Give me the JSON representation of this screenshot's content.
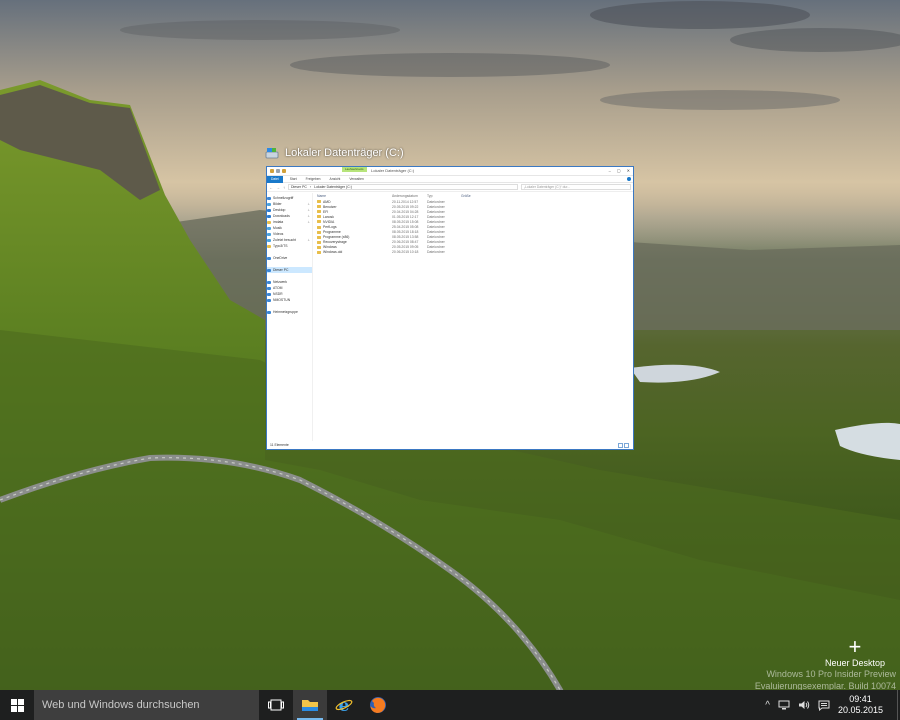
{
  "task_view": {
    "window_title": "Lokaler Datenträger (C:)"
  },
  "explorer": {
    "context_tab": "Laufwerktools",
    "title": "Lokaler Datenträger (C:)",
    "controls": [
      "–",
      "▢",
      "✕"
    ],
    "ribbon_tabs": [
      "Datei",
      "Start",
      "Freigeben",
      "Ansicht",
      "Verwalten"
    ],
    "address_parts": [
      "Dieser PC",
      "Lokaler Datenträger (C:)"
    ],
    "search_placeholder": "„Lokaler Datenträger (C:)“ dur...",
    "nav_items": [
      {
        "label": "Schnellzugriff",
        "icon": "star-icon",
        "color": "#3a86d6",
        "pinned": false,
        "selected": false
      },
      {
        "label": "Bilder",
        "icon": "pictures-icon",
        "color": "#4aa3df",
        "pinned": true,
        "selected": false
      },
      {
        "label": "Desktop",
        "icon": "desktop-icon",
        "color": "#2b7bd0",
        "pinned": true,
        "selected": false
      },
      {
        "label": "Downloads",
        "icon": "download-icon",
        "color": "#2b7bd0",
        "pinned": true,
        "selected": false
      },
      {
        "label": "imdata",
        "icon": "folder-icon",
        "color": "#e8be4a",
        "pinned": true,
        "selected": false
      },
      {
        "label": "Musik",
        "icon": "music-icon",
        "color": "#4aa3df",
        "pinned": false,
        "selected": false
      },
      {
        "label": "Videos",
        "icon": "video-icon",
        "color": "#4aa3df",
        "pinned": false,
        "selected": false
      },
      {
        "label": "Zuletzt besucht",
        "icon": "recent-icon",
        "color": "#4aa3df",
        "pinned": true,
        "selected": false
      },
      {
        "label": "Typo3/TS",
        "icon": "folder-icon",
        "color": "#e8be4a",
        "pinned": false,
        "selected": false
      },
      {
        "label": "",
        "icon": "",
        "color": "",
        "pinned": false,
        "selected": false
      },
      {
        "label": "OneDrive",
        "icon": "cloud-icon",
        "color": "#3a86d6",
        "pinned": false,
        "selected": false
      },
      {
        "label": "",
        "icon": "",
        "color": "",
        "pinned": false,
        "selected": false
      },
      {
        "label": "Dieser PC",
        "icon": "computer-icon",
        "color": "#3a86d6",
        "pinned": false,
        "selected": true
      },
      {
        "label": "",
        "icon": "",
        "color": "",
        "pinned": false,
        "selected": false
      },
      {
        "label": "Netzwerk",
        "icon": "network-icon",
        "color": "#3a86d6",
        "pinned": false,
        "selected": false
      },
      {
        "label": "ATOM",
        "icon": "computer-icon",
        "color": "#3a86d6",
        "pinned": false,
        "selected": false
      },
      {
        "label": "NSDR",
        "icon": "computer-icon",
        "color": "#3a86d6",
        "pinned": false,
        "selected": false
      },
      {
        "label": "NMOSTUN",
        "icon": "computer-icon",
        "color": "#3a86d6",
        "pinned": false,
        "selected": false
      },
      {
        "label": "",
        "icon": "",
        "color": "",
        "pinned": false,
        "selected": false
      },
      {
        "label": "Heimnetzgruppe",
        "icon": "homegroup-icon",
        "color": "#3a86d6",
        "pinned": false,
        "selected": false
      }
    ],
    "columns": [
      "Name",
      "Änderungsdatum",
      "Typ",
      "Größe"
    ],
    "files": [
      {
        "name": "AMD",
        "date": "20.11.2014 12:57",
        "type": "Dateiordner"
      },
      {
        "name": "Benutzer",
        "date": "20.05.2015 09:22",
        "type": "Dateiordner"
      },
      {
        "name": "EFI",
        "date": "20.04.2015 04:28",
        "type": "Dateiordner"
      },
      {
        "name": "Lanosk",
        "date": "01.05.2015 12:17",
        "type": "Dateiordner"
      },
      {
        "name": "NVIDIA",
        "date": "08.05.2015 15:08",
        "type": "Dateiordner"
      },
      {
        "name": "PerfLogs",
        "date": "25.04.2015 05:08",
        "type": "Dateiordner"
      },
      {
        "name": "Programme",
        "date": "08.05.2015 18:18",
        "type": "Dateiordner"
      },
      {
        "name": "Programme (x86)",
        "date": "08.05.2015 13:58",
        "type": "Dateiordner"
      },
      {
        "name": "Recoverystrage",
        "date": "20.06.2015 08:47",
        "type": "Dateiordner"
      },
      {
        "name": "Windows",
        "date": "20.05.2015 09:05",
        "type": "Dateiordner"
      },
      {
        "name": "Windows.old",
        "date": "20.06.2015 10:18",
        "type": "Dateiordner"
      }
    ],
    "status": "11 Elemente"
  },
  "new_desktop": {
    "plus": "+",
    "label": "Neuer Desktop"
  },
  "watermark": {
    "line1": "Windows 10 Pro Insider Preview",
    "line2": "Evaluierungsexemplar. Build 10074"
  },
  "taskbar": {
    "search_placeholder": "Web und Windows durchsuchen",
    "time": "09:41",
    "date": "20.05.2015",
    "accent": "#76b9ed"
  }
}
